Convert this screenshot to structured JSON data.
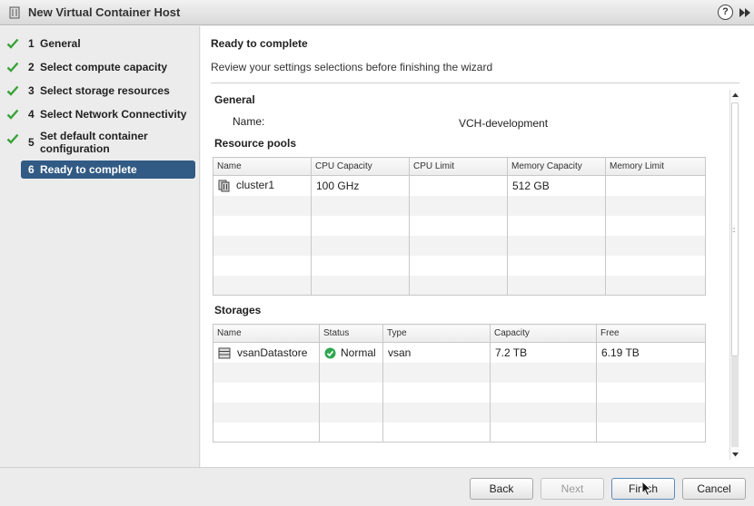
{
  "window": {
    "title": "New Virtual Container Host",
    "help_icon": "?"
  },
  "steps": [
    {
      "num": "1",
      "label": "General",
      "done": true
    },
    {
      "num": "2",
      "label": "Select compute capacity",
      "done": true
    },
    {
      "num": "3",
      "label": "Select storage resources",
      "done": true
    },
    {
      "num": "4",
      "label": "Select Network Connectivity",
      "done": true
    },
    {
      "num": "5",
      "label": "Set default container configuration",
      "done": true
    },
    {
      "num": "6",
      "label": "Ready to complete",
      "done": false,
      "active": true
    }
  ],
  "main": {
    "title": "Ready to complete",
    "description": "Review your settings selections before finishing the wizard",
    "general": {
      "heading": "General",
      "name_label": "Name:",
      "name_value": "VCH-development"
    },
    "resource_pools": {
      "heading": "Resource pools",
      "columns": [
        "Name",
        "CPU Capacity",
        "CPU Limit",
        "Memory Capacity",
        "Memory Limit"
      ],
      "rows": [
        {
          "name": "cluster1",
          "cpu_capacity": "100 GHz",
          "cpu_limit": "",
          "memory_capacity": "512 GB",
          "memory_limit": ""
        }
      ]
    },
    "storages": {
      "heading": "Storages",
      "columns": [
        "Name",
        "Status",
        "Type",
        "Capacity",
        "Free"
      ],
      "rows": [
        {
          "name": "vsanDatastore",
          "status": "Normal",
          "type": "vsan",
          "capacity": "7.2 TB",
          "free": "6.19 TB"
        }
      ]
    }
  },
  "footer": {
    "back": "Back",
    "next": "Next",
    "finish": "Finish",
    "cancel": "Cancel"
  },
  "colors": {
    "active_step": "#315a84",
    "check": "#3aa23a",
    "status_ok": "#2fa84f"
  }
}
